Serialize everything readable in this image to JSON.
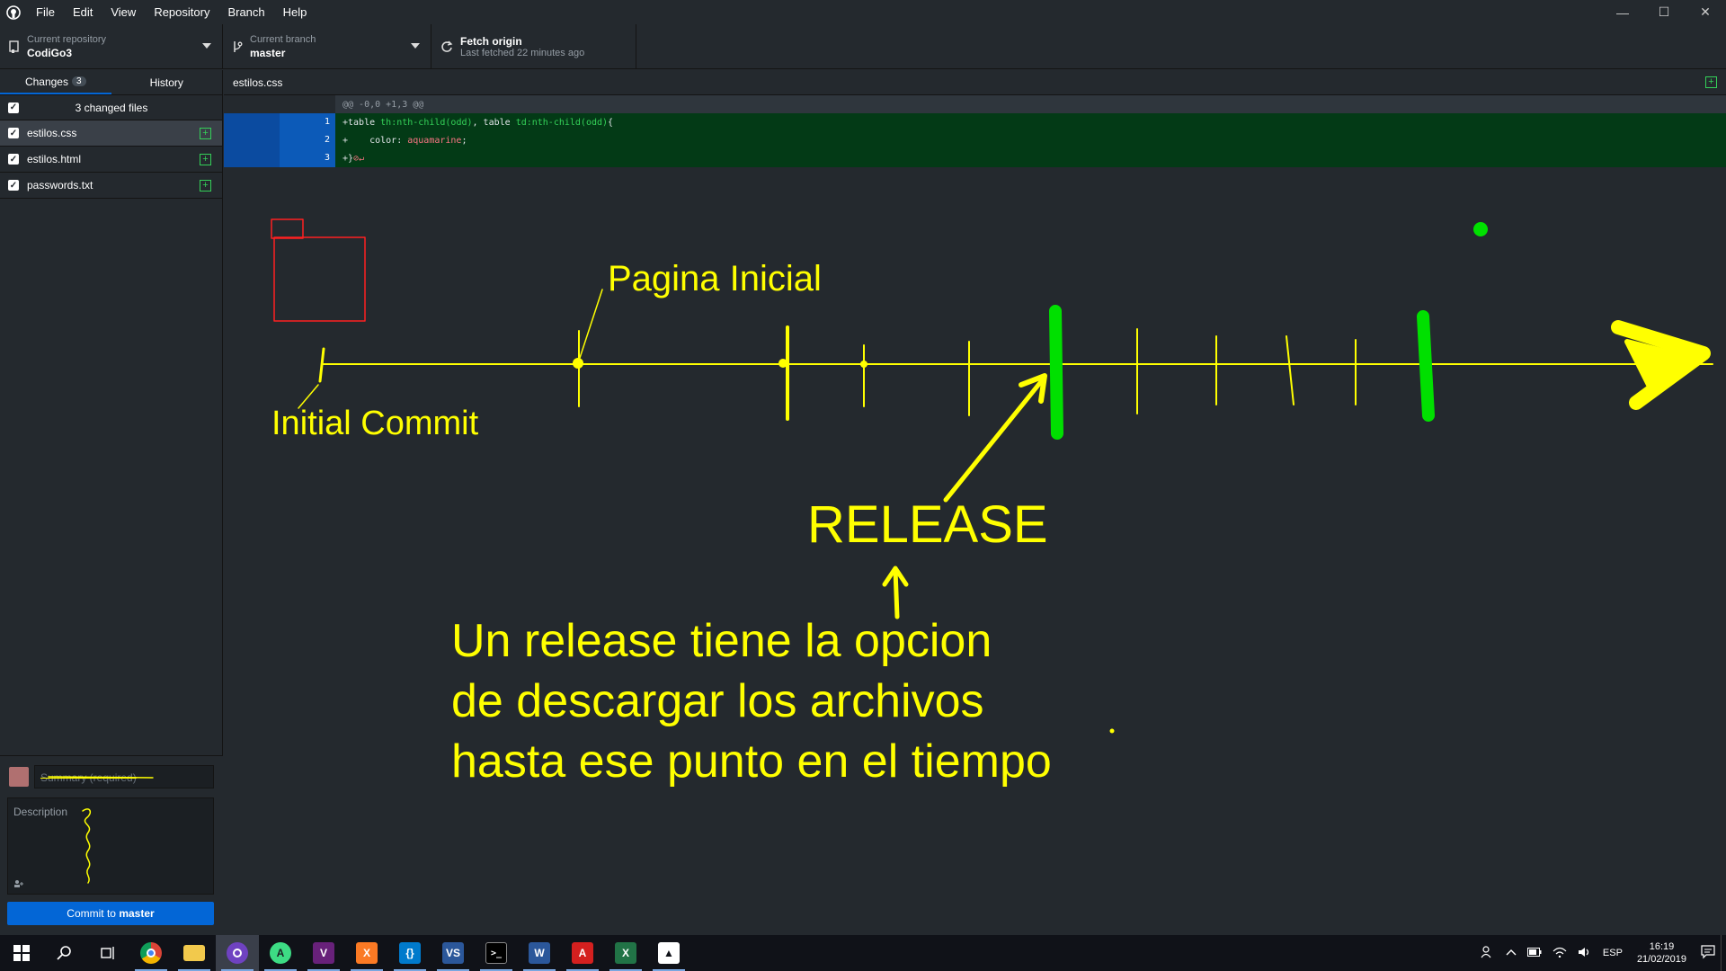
{
  "menu": [
    "File",
    "Edit",
    "View",
    "Repository",
    "Branch",
    "Help"
  ],
  "window_controls": [
    "—",
    "☐",
    "✕"
  ],
  "toolbar": {
    "repo_label": "Current repository",
    "repo_value": "CodiGo3",
    "branch_label": "Current branch",
    "branch_value": "master",
    "fetch_label": "Fetch origin",
    "fetch_sub": "Last fetched 22 minutes ago"
  },
  "tabs": {
    "changes": "Changes",
    "changes_count": "3",
    "history": "History"
  },
  "changed_header": "3 changed files",
  "files": [
    "estilos.css",
    "estilos.html",
    "passwords.txt"
  ],
  "commit": {
    "summary_placeholder": "Summary (required)",
    "description_placeholder": "Description",
    "button_prefix": "Commit to ",
    "button_branch": "master"
  },
  "diff": {
    "filename": "estilos.css",
    "hunk": "@@ -0,0 +1,3 @@",
    "lines": [
      {
        "num": "1",
        "parts": [
          "+table ",
          "th:nth-child(odd)",
          ", table ",
          "td:nth-child(odd)",
          "{"
        ]
      },
      {
        "num": "2",
        "parts": [
          "+    color: ",
          "aquamarine",
          ";"
        ]
      },
      {
        "num": "3",
        "parts": [
          "+}",
          "⊘↵"
        ]
      }
    ]
  },
  "annotations": {
    "pagina_inicial": "Pagina Inicial",
    "initial_commit": "Initial Commit",
    "release": "RELEASE",
    "desc_line1": "Un release tiene la opcion",
    "desc_line2": "de descargar los archivos",
    "desc_line3": "hasta ese punto en el tiempo",
    "ink_yellow": "#ffff00",
    "ink_green": "#00e000",
    "ink_red": "#ff2020"
  },
  "taskbar": {
    "apps": [
      "windows-start-icon",
      "search-icon",
      "task-view-icon",
      "chrome-icon",
      "file-explorer-icon",
      "github-desktop-icon",
      "android-studio-icon",
      "visual-studio-icon",
      "xampp-icon",
      "vscode-icon",
      "visual-studio-installer-icon",
      "terminal-icon",
      "word-icon",
      "acrobat-icon",
      "excel-icon",
      "photos-icon"
    ],
    "language": "ESP",
    "time": "16:19",
    "date": "21/02/2019"
  }
}
